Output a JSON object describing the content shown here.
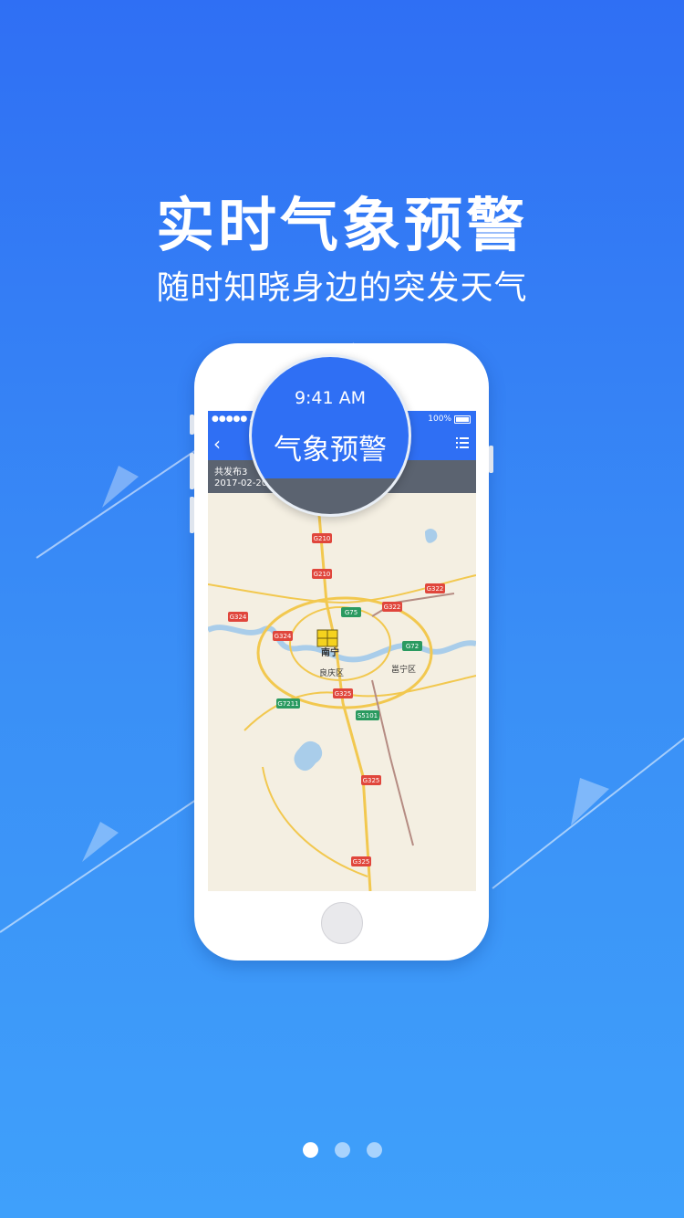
{
  "headline": "实时气象预警",
  "subline": "随时知晓身边的突发天气",
  "phone": {
    "status": {
      "carrier": "●●●●● AT",
      "battery": "100%"
    },
    "magnifier": {
      "time": "9:41 AM",
      "title": "气象预警"
    },
    "info": {
      "line1": "共发布3",
      "line2": "2017-02-20"
    },
    "map": {
      "city": "南宁",
      "districts": [
        "良庆区",
        "邕宁区"
      ],
      "roads": [
        "G210",
        "G210",
        "G322",
        "G322",
        "G324",
        "G324",
        "G75",
        "G72",
        "G325",
        "G7211",
        "S5101",
        "G325",
        "G325"
      ]
    }
  },
  "pager": {
    "count": 3,
    "active": 0
  },
  "colors": {
    "brand_blue": "#2f6ff4",
    "info_gray": "#5b6370",
    "map_bg": "#f4efe2",
    "road_red": "#e0463c",
    "road_green": "#2a9a60"
  }
}
